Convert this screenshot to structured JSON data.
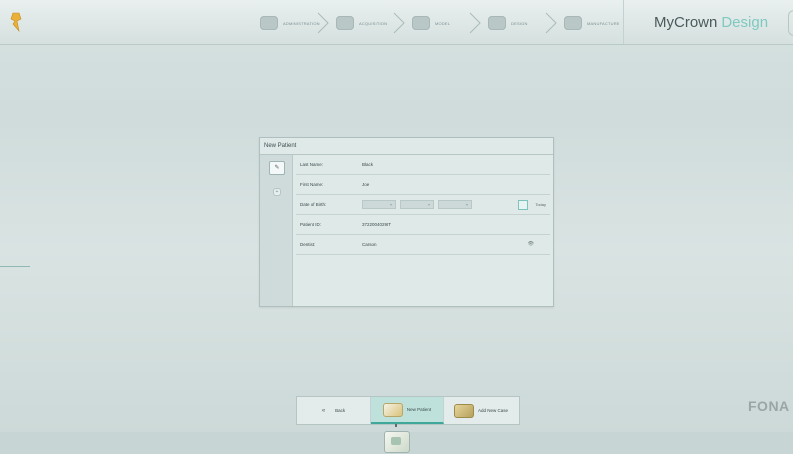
{
  "app": {
    "brand_part1": "MyCrown",
    "brand_part2": "Design",
    "accent_color": "#7fc9c0"
  },
  "workflow_steps": [
    {
      "label": "ADMINISTRATION",
      "icon": "administration-icon"
    },
    {
      "label": "ACQUISITION",
      "icon": "acquisition-icon"
    },
    {
      "label": "MODEL",
      "icon": "model-icon"
    },
    {
      "label": "DESIGN",
      "icon": "design-icon"
    },
    {
      "label": "MANUFACTURE",
      "icon": "manufacture-icon"
    }
  ],
  "dialog": {
    "title": "New Patient",
    "fields": {
      "last_name_label": "Last Name:",
      "last_name_value": "Black",
      "first_name_label": "First Name:",
      "first_name_value": "Joe",
      "dob_label": "Date of Birth:",
      "today_label": "Today",
      "patient_id_label": "Patient ID:",
      "patient_id_value": "3722004029IT",
      "dentist_label": "Dentist:",
      "dentist_value": "Carson"
    }
  },
  "toolbar": {
    "back_label": "Back",
    "new_patient_label": "New Patient",
    "add_new_case_label": "Add New Case"
  },
  "footer": {
    "logo_text": "FONA"
  }
}
